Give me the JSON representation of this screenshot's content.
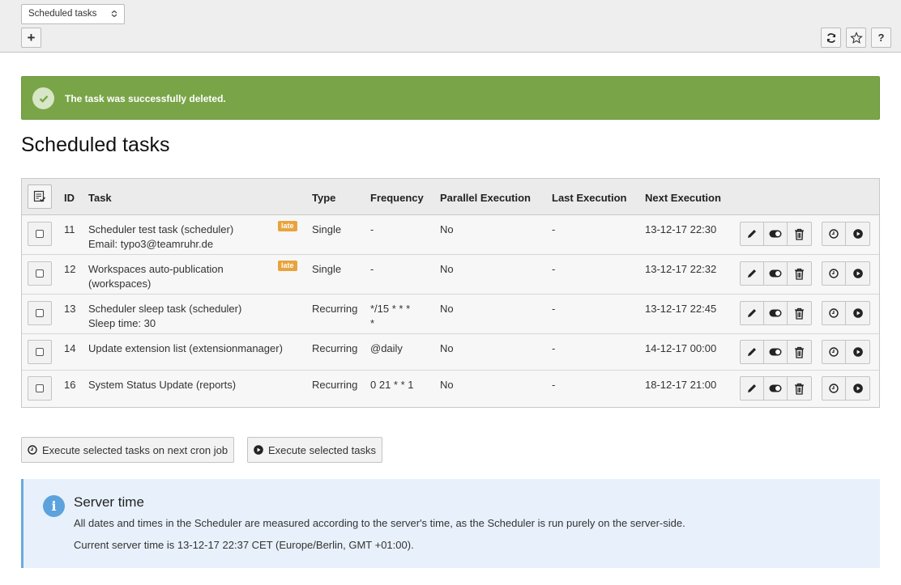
{
  "header": {
    "module_select": "Scheduled tasks",
    "add_label": "+",
    "help_label": "?"
  },
  "alert": {
    "message": "The task was successfully deleted."
  },
  "page_title": "Scheduled tasks",
  "table": {
    "columns": [
      "ID",
      "Task",
      "Type",
      "Frequency",
      "Parallel Execution",
      "Last Execution",
      "Next Execution"
    ],
    "rows": [
      {
        "id": "11",
        "task": "Scheduler test task (scheduler)",
        "task_detail": "Email: typo3@teamruhr.de",
        "late": "late",
        "type": "Single",
        "frequency": "-",
        "parallel": "No",
        "last": "-",
        "next": "13-12-17 22:30"
      },
      {
        "id": "12",
        "task": "Workspaces auto-publication",
        "task_detail": "(workspaces)",
        "late": "late",
        "type": "Single",
        "frequency": "-",
        "parallel": "No",
        "last": "-",
        "next": "13-12-17 22:32"
      },
      {
        "id": "13",
        "task": "Scheduler sleep task (scheduler)",
        "task_detail": "Sleep time: 30",
        "late": "",
        "type": "Recurring",
        "frequency": "*/15 * * *",
        "frequency2": "*",
        "parallel": "No",
        "last": "-",
        "next": "13-12-17 22:45"
      },
      {
        "id": "14",
        "task": "Update extension list (extensionmanager)",
        "task_detail": "",
        "late": "",
        "type": "Recurring",
        "frequency": "@daily",
        "parallel": "No",
        "last": "-",
        "next": "14-12-17 00:00"
      },
      {
        "id": "16",
        "task": "System Status Update (reports)",
        "task_detail": "",
        "late": "",
        "type": "Recurring",
        "frequency": "0 21 * * 1",
        "parallel": "No",
        "last": "-",
        "next": "18-12-17 21:00"
      }
    ]
  },
  "buttons": {
    "execute_cron": "Execute selected tasks on next cron job",
    "execute_now": "Execute selected tasks"
  },
  "info": {
    "title": "Server time",
    "text": "All dates and times in the Scheduler are measured according to the server's time, as the Scheduler is run purely on the server-side.",
    "current": "Current server time is 13-12-17 22:37 CET (Europe/Berlin, GMT +01:00)."
  },
  "colors": {
    "success": "#79a548",
    "late_badge": "#e8a33d",
    "info_bg": "#e8f1fb",
    "info_accent": "#5ca3dd"
  }
}
